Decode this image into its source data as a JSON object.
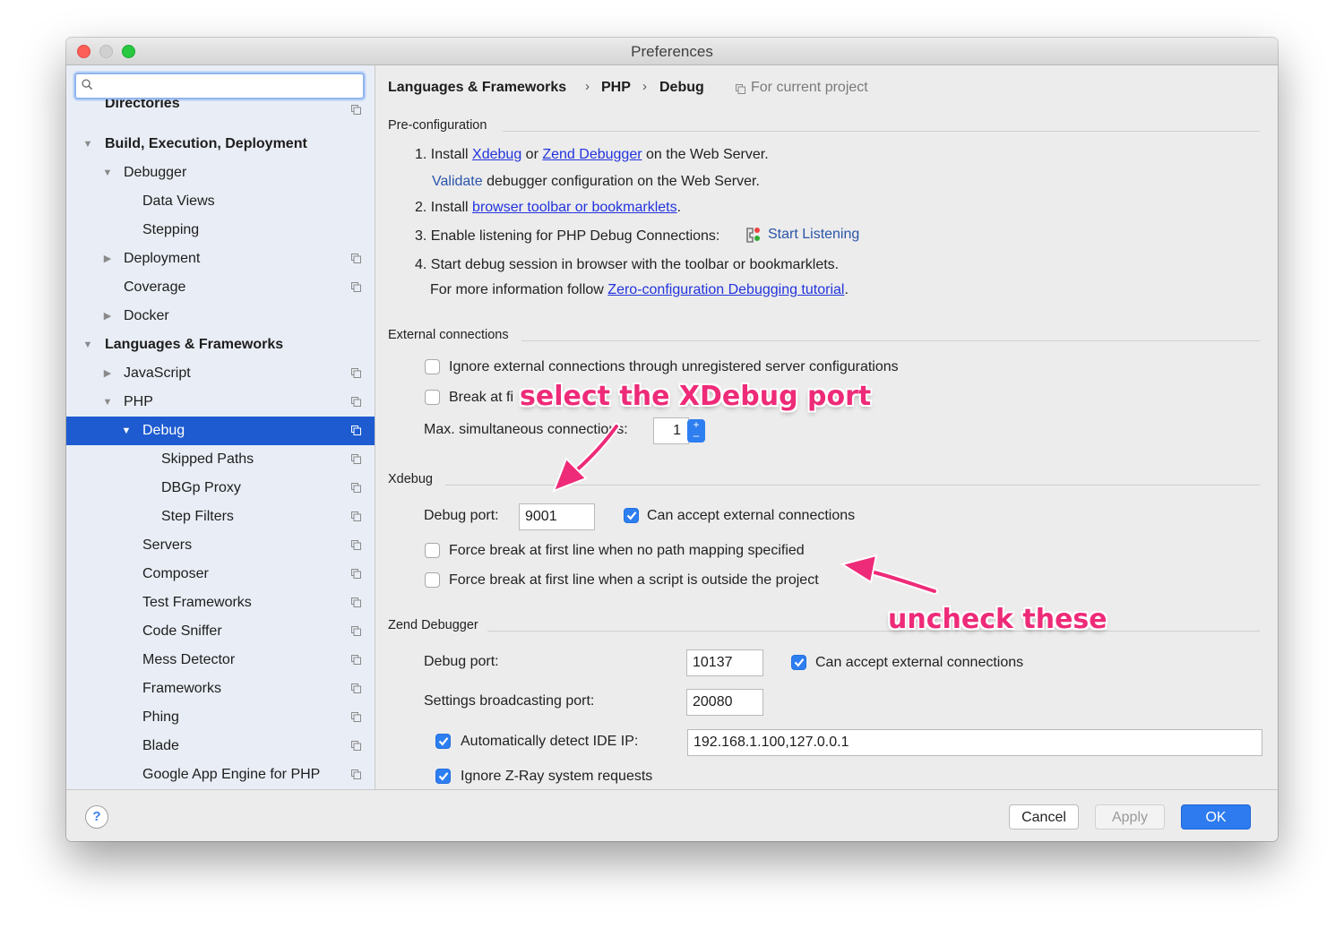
{
  "window": {
    "title": "Preferences"
  },
  "search": {
    "placeholder": "",
    "value": ""
  },
  "sidebar": {
    "items": [
      {
        "label": "Directories"
      },
      {
        "label": "Build, Execution, Deployment"
      },
      {
        "label": "Debugger"
      },
      {
        "label": "Data Views"
      },
      {
        "label": "Stepping"
      },
      {
        "label": "Deployment"
      },
      {
        "label": "Coverage"
      },
      {
        "label": "Docker"
      },
      {
        "label": "Languages & Frameworks"
      },
      {
        "label": "JavaScript"
      },
      {
        "label": "PHP"
      },
      {
        "label": "Debug"
      },
      {
        "label": "Skipped Paths"
      },
      {
        "label": "DBGp Proxy"
      },
      {
        "label": "Step Filters"
      },
      {
        "label": "Servers"
      },
      {
        "label": "Composer"
      },
      {
        "label": "Test Frameworks"
      },
      {
        "label": "Code Sniffer"
      },
      {
        "label": "Mess Detector"
      },
      {
        "label": "Frameworks"
      },
      {
        "label": "Phing"
      },
      {
        "label": "Blade"
      },
      {
        "label": "Google App Engine for PHP"
      }
    ],
    "selected": "Debug"
  },
  "breadcrumb": {
    "items": [
      "Languages & Frameworks",
      "PHP",
      "Debug"
    ],
    "separator": "›",
    "scope": "For current project"
  },
  "preconfig": {
    "title": "Pre-configuration",
    "step1_prefix": "1. Install",
    "xdebug_link": "Xdebug",
    "or": "or",
    "zend_link": "Zend Debugger",
    "step1_suffix": "on the Web Server.",
    "validate_link": "Validate",
    "validate_suffix": "debugger configuration on the Web Server.",
    "step2_prefix": "2. Install",
    "step2_link": "browser toolbar or bookmarklets",
    "step2_suffix": ".",
    "step3": "3. Enable listening for PHP Debug Connections:",
    "start_listening": "Start Listening",
    "step4": "4. Start debug session in browser with the toolbar or bookmarklets.",
    "more_prefix": "For more information follow",
    "more_link": "Zero-configuration Debugging tutorial",
    "more_suffix": "."
  },
  "external": {
    "title": "External connections",
    "ignore_label": "Ignore external connections through unregistered server configurations",
    "ignore_checked": false,
    "break_label": "Break at fi",
    "break_label_tail": "r",
    "break_label_tail2": "s",
    "break_checked": false,
    "max_label": "Max. simultaneous connections:",
    "max_value": "1"
  },
  "xdebug": {
    "title": "Xdebug",
    "port_label": "Debug port:",
    "port_value": "9001",
    "accept_label": "Can accept external connections",
    "accept_checked": true,
    "force_nomap_label": "Force break at first line when no path mapping specified",
    "force_nomap_checked": false,
    "force_outside_label": "Force break at first line when a script is outside the project",
    "force_outside_checked": false
  },
  "zend": {
    "title": "Zend Debugger",
    "port_label": "Debug port:",
    "port_value": "10137",
    "accept_label": "Can accept external connections",
    "accept_checked": true,
    "broadcast_label": "Settings broadcasting port:",
    "broadcast_value": "20080",
    "detect_label": "Automatically detect IDE IP:",
    "detect_checked": true,
    "ip_value": "192.168.1.100,127.0.0.1",
    "zray_label": "Ignore Z-Ray system requests",
    "zray_checked": true
  },
  "footer": {
    "help": "?",
    "cancel": "Cancel",
    "apply": "Apply",
    "ok": "OK"
  },
  "annotations": {
    "select_port": "select the XDebug port",
    "uncheck": "uncheck these"
  },
  "colors": {
    "selection": "#1e5bd0",
    "link": "#2233dd",
    "annotation": "#ee2b78",
    "checkbox": "#2d7ef0"
  }
}
